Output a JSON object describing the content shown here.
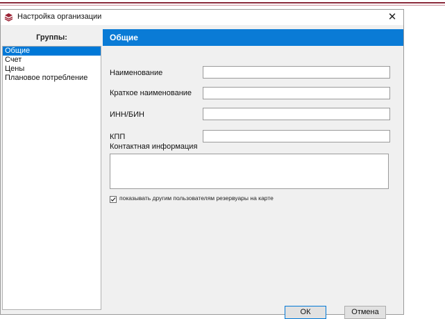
{
  "window": {
    "title": "Настройка организации",
    "close_glyph": "✕"
  },
  "groups": {
    "header": "Группы:",
    "items": [
      {
        "label": "Общие",
        "selected": true
      },
      {
        "label": "Счет"
      },
      {
        "label": "Цены"
      },
      {
        "label": "Плановое потребление"
      }
    ]
  },
  "section": {
    "title": "Общие"
  },
  "form": {
    "name_label": "Наименование",
    "short_name_label": "Краткое наименование",
    "inn_label": "ИНН/БИН",
    "kpp_label": "КПП",
    "contact_label": "Контактная информация",
    "show_tanks_label": "показывать другим пользователям резервуары на карте",
    "show_tanks_checked": true
  },
  "buttons": {
    "ok": "ОК",
    "cancel": "Отмена"
  },
  "colors": {
    "accent": "#0a7bd6",
    "selection": "#0078d7",
    "brand_line": "#8a2a3a"
  }
}
